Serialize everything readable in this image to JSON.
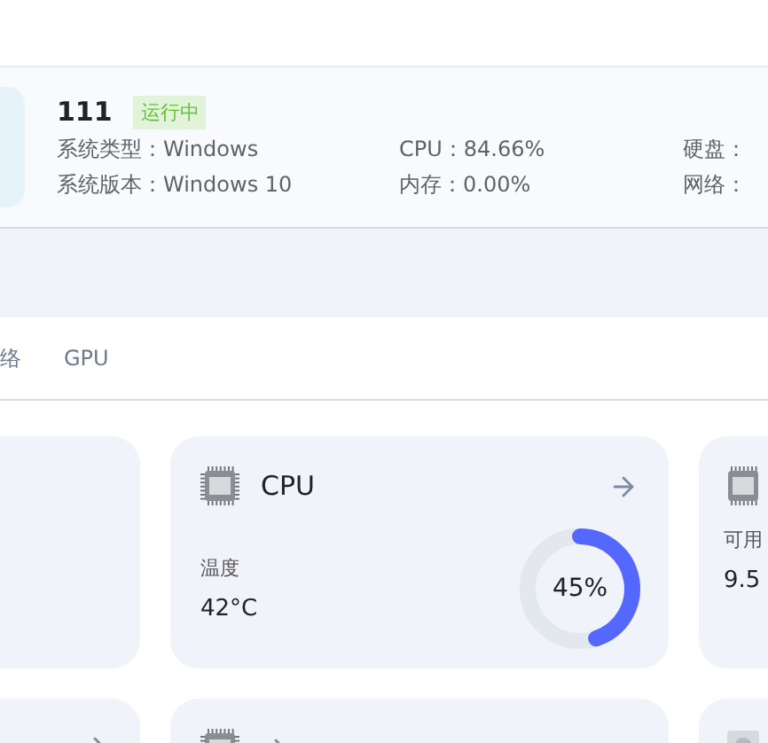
{
  "server": {
    "name": "111",
    "status": "运行中",
    "running": true,
    "columns": [
      [
        {
          "label": "系统类型：",
          "value": "Windows"
        },
        {
          "label": "系统版本：",
          "value": "Windows 10"
        }
      ],
      [
        {
          "label": "CPU：",
          "value": "84.66%"
        },
        {
          "label": "内存：",
          "value": "0.00%"
        }
      ],
      [
        {
          "label": "硬盘："
        },
        {
          "label": "网络："
        }
      ]
    ]
  },
  "tabs": [
    {
      "label": "络",
      "selected": false
    },
    {
      "label": "GPU",
      "selected": false
    }
  ],
  "rows": [
    [
      {
        "kind": "blank"
      },
      {
        "kind": "cpu",
        "title": "CPU",
        "metric_label": "温度",
        "metric_value": "42°C",
        "usage": "45%",
        "level": 0.45
      },
      {
        "kind": "ram",
        "metric_label": "可用",
        "metric_value": "9.5"
      }
    ],
    [
      {
        "kind": "blank",
        "arrow": true
      },
      {
        "kind": "cpu"
      },
      {
        "kind": "disk"
      }
    ]
  ]
}
